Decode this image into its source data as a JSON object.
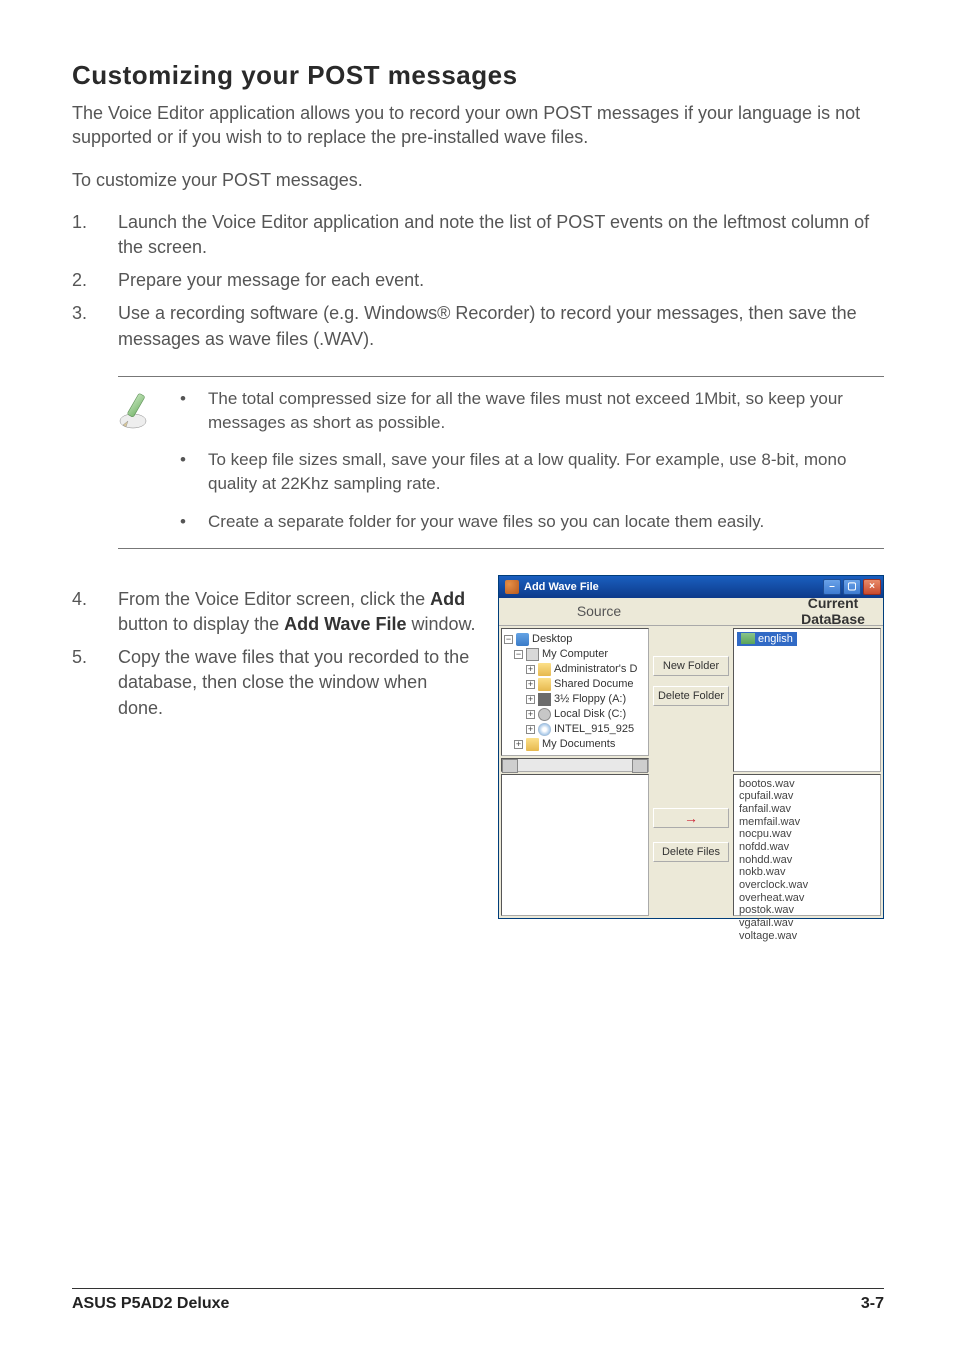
{
  "heading": "Customizing your POST messages",
  "intro": "The Voice Editor application allows you to record your own POST messages if your language is not supported or if you wish to  to replace the pre-installed wave files.",
  "intro2": "To customize your POST messages.",
  "steps_top": [
    "Launch the Voice Editor application and note the list of POST events on the leftmost column of the screen.",
    "Prepare your message for each event.",
    "Use a recording software (e.g. Windows® Recorder) to record your messages, then save the messages as wave files (.WAV)."
  ],
  "note_bullets": [
    "The total compressed size for all the wave files must not exceed 1Mbit, so keep your messages as short as possible.",
    "To keep file sizes small, save your files at a low quality. For example, use 8-bit, mono quality at 22Khz sampling rate.",
    "Create a separate folder for your wave files so you can locate them easily."
  ],
  "step4": {
    "prefix": "From the Voice Editor screen, click the ",
    "bold1": "Add",
    "mid": " button to display the ",
    "bold2": "Add Wave File",
    "suffix": " window."
  },
  "step5": "Copy the wave files that you recorded to the database, then close the window when done.",
  "window": {
    "title": "Add Wave File",
    "source_label": "Source",
    "database_label": "Current DataBase",
    "new_folder_btn": "New Folder",
    "delete_folder_btn": "Delete Folder",
    "delete_files_btn": "Delete Files",
    "language_selected": "english",
    "tree": {
      "desktop": "Desktop",
      "mycomputer": "My Computer",
      "admin": "Administrator's D",
      "shared": "Shared Docume",
      "floppy": "3½ Floppy (A:)",
      "localdisk": "Local Disk (C:)",
      "intel": "INTEL_915_925",
      "mydocs": "My Documents"
    },
    "db_files": [
      "bootos.wav",
      "cpufail.wav",
      "fanfail.wav",
      "memfail.wav",
      "nocpu.wav",
      "nofdd.wav",
      "nohdd.wav",
      "nokb.wav",
      "overclock.wav",
      "overheat.wav",
      "postok.wav",
      "vgafail.wav",
      "voltage.wav"
    ],
    "arrow": "→"
  },
  "footer_left": "ASUS P5AD2 Deluxe",
  "footer_right": "3-7"
}
